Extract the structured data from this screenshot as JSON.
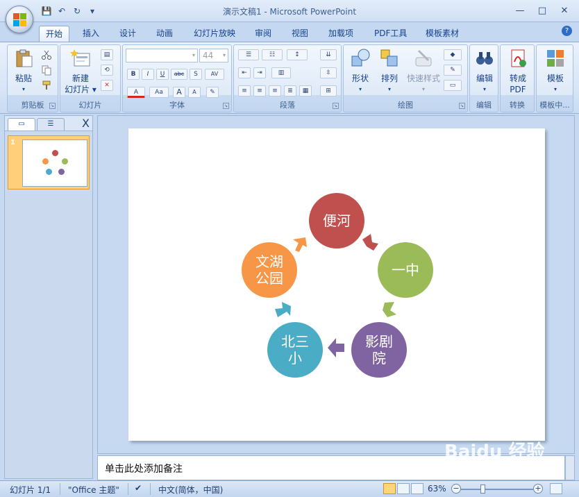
{
  "window": {
    "title": "演示文稿1 - Microsoft PowerPoint",
    "minimize": "—",
    "maximize": "□",
    "close": "✕"
  },
  "qat": {
    "save": "💾",
    "undo": "↶",
    "redo": "↻",
    "more": "▾"
  },
  "tabs": [
    {
      "label": "开始"
    },
    {
      "label": "插入"
    },
    {
      "label": "设计"
    },
    {
      "label": "动画"
    },
    {
      "label": "幻灯片放映"
    },
    {
      "label": "审阅"
    },
    {
      "label": "视图"
    },
    {
      "label": "加载项"
    },
    {
      "label": "PDF工具"
    },
    {
      "label": "模板素材"
    }
  ],
  "ribbon": {
    "clipboard": {
      "label": "剪贴板",
      "paste": "粘贴"
    },
    "slides": {
      "label": "幻灯片",
      "new_slide_line1": "新建",
      "new_slide_line2": "幻灯片"
    },
    "font": {
      "label": "字体",
      "font_name": "",
      "font_size": "44",
      "bold": "B",
      "italic": "I",
      "underline": "U",
      "strike": "abc",
      "shadow": "S",
      "spacing": "AV",
      "color": "A",
      "case": "Aa",
      "grow": "A",
      "shrink": "A"
    },
    "paragraph": {
      "label": "段落"
    },
    "drawing": {
      "label": "绘图",
      "shape": "形状",
      "arrange": "排列",
      "quick_style": "快速样式"
    },
    "editing": {
      "label": "编辑",
      "edit": "编辑"
    },
    "convert": {
      "label": "转换",
      "to_pdf_line1": "转成",
      "to_pdf_line2": "PDF"
    },
    "template": {
      "label": "模板中...",
      "template": "模板"
    }
  },
  "slide_panel": {
    "slide_number": "1",
    "close": "X"
  },
  "diagram": {
    "nodes": [
      {
        "text": "便河",
        "color": "#c0504d"
      },
      {
        "text": "一中",
        "color": "#9bbb59"
      },
      {
        "text": "影剧院",
        "color": "#8064a2"
      },
      {
        "text": "北三小",
        "color": "#4bacc6"
      },
      {
        "text": "文湖公园",
        "color": "#f79646"
      }
    ]
  },
  "notes": {
    "placeholder": "单击此处添加备注"
  },
  "status": {
    "slide_count": "幻灯片 1/1",
    "theme": "\"Office 主题\"",
    "language": "中文(简体，中国)",
    "zoom": "63%"
  },
  "watermark": "Baidu 经验"
}
